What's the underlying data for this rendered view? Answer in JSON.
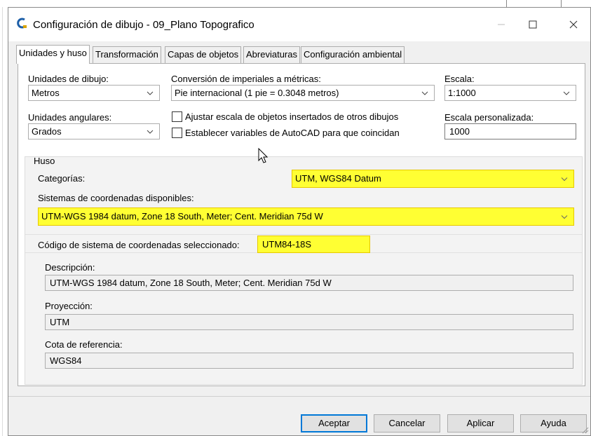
{
  "window": {
    "title": "Configuración de dibujo - 09_Plano Topografico"
  },
  "tabs": [
    {
      "label": "Unidades y huso",
      "active": true
    },
    {
      "label": "Transformación",
      "active": false
    },
    {
      "label": "Capas de objetos",
      "active": false
    },
    {
      "label": "Abreviaturas",
      "active": false
    },
    {
      "label": "Configuración ambiental",
      "active": false
    }
  ],
  "units": {
    "drawing_units_label": "Unidades de dibujo:",
    "drawing_units_value": "Metros",
    "conversion_label": "Conversión de imperiales a métricas:",
    "conversion_value": "Pie internacional (1 pie = 0.3048 metros)",
    "scale_label": "Escala:",
    "scale_value": "1:1000",
    "angular_units_label": "Unidades angulares:",
    "angular_units_value": "Grados",
    "scale_objects_checkbox": "Ajustar escala de objetos insertados de otros dibujos",
    "set_variables_checkbox": "Establecer variables de AutoCAD para que coincidan",
    "custom_scale_label": "Escala personalizada:",
    "custom_scale_value": "1000"
  },
  "zone": {
    "group_label": "Huso",
    "categories_label": "Categorías:",
    "categories_value": "UTM, WGS84 Datum",
    "available_systems_label": "Sistemas de coordenadas disponibles:",
    "available_systems_value": "UTM-WGS 1984 datum, Zone 18 South, Meter; Cent. Meridian 75d W",
    "selected_code_label": "Código de sistema de coordenadas seleccionado:",
    "selected_code_value": "UTM84-18S",
    "description_label": "Descripción:",
    "description_value": "UTM-WGS 1984 datum, Zone 18 South, Meter; Cent. Meridian 75d W",
    "projection_label": "Proyección:",
    "projection_value": "UTM",
    "datum_label": "Cota de referencia:",
    "datum_value": "WGS84"
  },
  "buttons": {
    "ok": "Aceptar",
    "cancel": "Cancelar",
    "apply": "Aplicar",
    "help": "Ayuda"
  },
  "colors": {
    "highlight": "#ffff33",
    "default_button_border": "#0078d7"
  },
  "icons": [
    "civil3d-app-icon",
    "minimize-icon",
    "maximize-icon",
    "close-icon",
    "chevron-down-icon",
    "mouse-cursor-icon"
  ]
}
